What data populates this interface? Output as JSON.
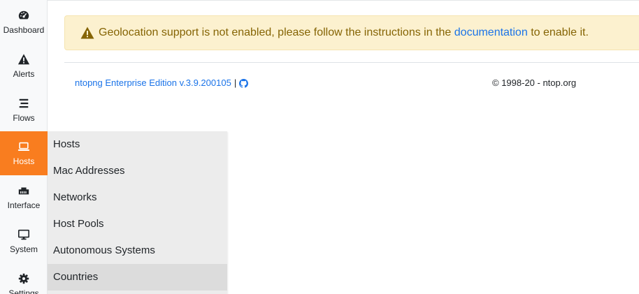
{
  "sidebar": {
    "items": [
      {
        "label": "Dashboard",
        "icon": "dashboard-icon"
      },
      {
        "label": "Alerts",
        "icon": "warning-icon"
      },
      {
        "label": "Flows",
        "icon": "stream-icon"
      },
      {
        "label": "Hosts",
        "icon": "laptop-icon",
        "active": true
      },
      {
        "label": "Interface",
        "icon": "ethernet-icon"
      },
      {
        "label": "System",
        "icon": "desktop-icon"
      },
      {
        "label": "Settings",
        "icon": "cog-icon"
      }
    ],
    "active_color": "#f97d1f"
  },
  "alert": {
    "text_before": "Geolocation support is not enabled, please follow the instructions in the",
    "link_text": "documentation",
    "text_after": "to enable it.",
    "icon": "warning-icon"
  },
  "footer": {
    "edition": "ntopng Enterprise Edition v.3.9.200105",
    "separator": "|",
    "github_icon": "github-icon",
    "copyright": "© 1998-20 - ntop.org"
  },
  "hosts_menu": {
    "items": [
      {
        "label": "Hosts"
      },
      {
        "label": "Mac Addresses"
      },
      {
        "label": "Networks"
      },
      {
        "label": "Host Pools"
      },
      {
        "label": "Autonomous Systems"
      },
      {
        "label": "Countries",
        "hover": true
      }
    ]
  },
  "colors": {
    "alert_bg": "#fcf1cf",
    "alert_text": "#856404",
    "link": "#1a73e8",
    "menu_bg": "#ececec"
  }
}
